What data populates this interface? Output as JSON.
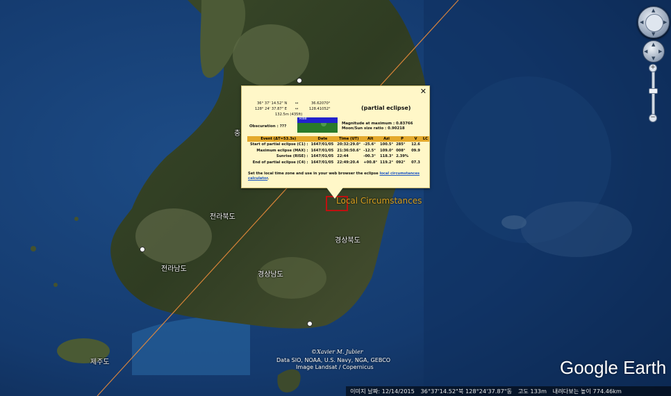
{
  "map": {
    "place_labels": [
      {
        "name": "kyungbuk-label",
        "text": "경상북도"
      },
      {
        "name": "kyungnam-label",
        "text": "경상남도"
      },
      {
        "name": "jeonbuk-label",
        "text": "전라북도"
      },
      {
        "name": "jeonnam-label",
        "text": "전라남도"
      },
      {
        "name": "jeju-label",
        "text": "제주도"
      },
      {
        "name": "chungbuk-label",
        "text": "충"
      }
    ],
    "placemark_label": "Local Circumstances",
    "credit": "©Xavier M. Jubier",
    "attribution_line1": "Data SIO, NOAA, U.S. Navy, NGA, GEBCO",
    "attribution_line2": "Image Landsat / Copernicus",
    "brand": "Google Earth"
  },
  "popup": {
    "close_glyph": "✕",
    "lat_dms": "36° 37' 14.52\" N",
    "lon_dms": "128° 24' 37.87\" E",
    "arrow": "↔",
    "lat_dec": "36.62070°",
    "lon_dec": "128.41052°",
    "elevation": "132.5m (435ft)",
    "title": "(partial eclipse)",
    "obscuration": "Obscuration : ???",
    "thumb_label": "Rise",
    "magnitude": "Magnitude at maximum : 0.83766",
    "ratio": "Moon/Sun size ratio : 0.90218",
    "table": {
      "headers": [
        "Event (ΔT=53.3s)",
        "Date",
        "Time (UT)",
        "Alt",
        "Azi",
        "P",
        "V",
        "LC"
      ],
      "rows": [
        [
          "Start of partial eclipse (C1) :",
          "1647/01/05",
          "20:32:29.0°",
          "-25.6°",
          "100.5°",
          "285°",
          "12.6",
          ""
        ],
        [
          "Maximum eclipse (MAX) :",
          "1647/01/05",
          "21:36:50.6°",
          "-12.5°",
          "109.0°",
          "008°",
          "09.9",
          ""
        ],
        [
          "Sunrise (RISE) :",
          "1647/01/05",
          "22:44",
          "-00.3°",
          "118.3°",
          "2.39%",
          "",
          ""
        ],
        [
          "End of partial eclipse (C4) :",
          "1647/01/05",
          "22:49:20.4",
          "+00.8°",
          "119.2°",
          "092°",
          "07.3",
          ""
        ]
      ]
    },
    "note_text": "Set the local time zone and use in your web browser the eclipse ",
    "note_link": "local circumstances calculator",
    "note_end": "."
  },
  "controls": {
    "zoom_plus": "+",
    "zoom_minus": "−",
    "zoom_level": 0.42
  },
  "status": {
    "imagery_date": "이미지 날짜: 12/14/2015",
    "coords": "36°37'14.52\"북 128°24'37.87\"동",
    "elevation": "고도 133m",
    "eye_alt": "내려다보는 높이 774.46km"
  },
  "colors": {
    "popup_bg": "#fff7c8",
    "table_header": "#e4a92c",
    "eclipse_path": "#e88b3a",
    "placemark_box": "#c01010"
  }
}
